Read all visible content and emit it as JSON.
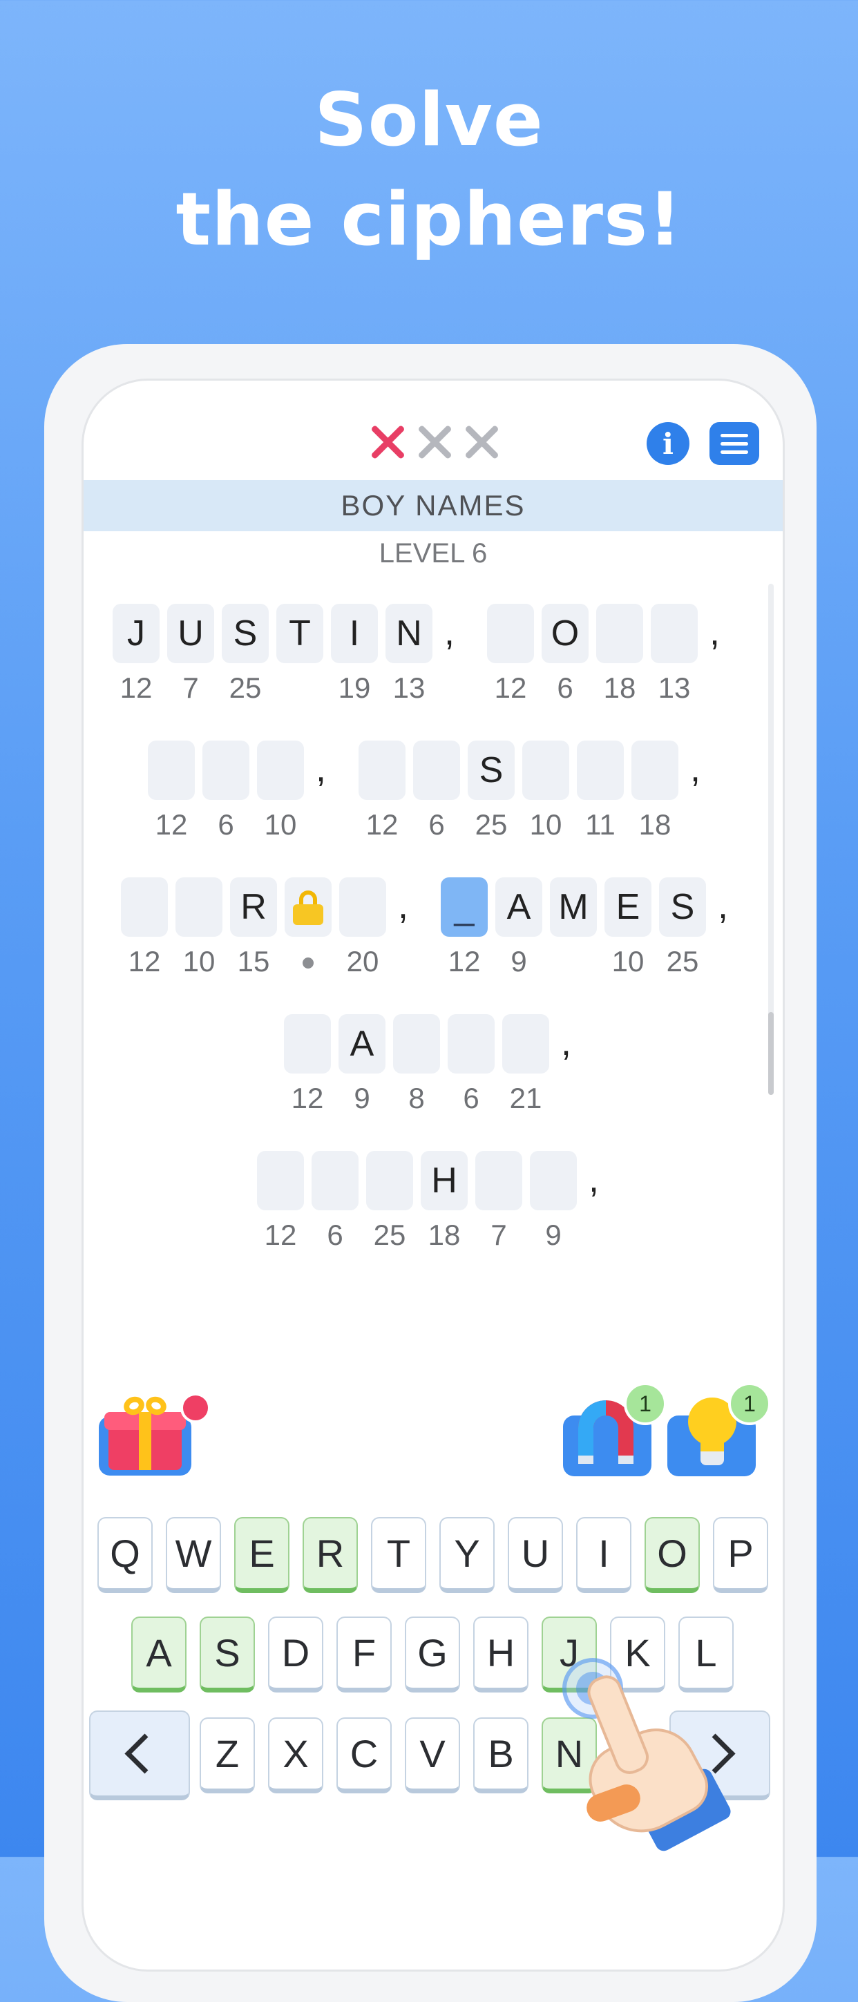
{
  "headline": {
    "line1": "Solve",
    "line2": "the ciphers!"
  },
  "game": {
    "mistakes": {
      "used": 1,
      "total": 3
    },
    "category": "BOY NAMES",
    "level": "LEVEL 6"
  },
  "puzzle": {
    "rows": [
      {
        "cells": [
          {
            "letter": "J",
            "num": "12"
          },
          {
            "letter": "U",
            "num": "7"
          },
          {
            "letter": "S",
            "num": "25"
          },
          {
            "letter": "T",
            "num": ""
          },
          {
            "letter": "I",
            "num": "19"
          },
          {
            "letter": "N",
            "num": "13"
          },
          {
            "punct": ","
          },
          {
            "letter": "",
            "num": "12"
          },
          {
            "letter": "O",
            "num": "6"
          },
          {
            "letter": "",
            "num": "18"
          },
          {
            "letter": "",
            "num": "13"
          },
          {
            "punct": ","
          }
        ]
      },
      {
        "cells": [
          {
            "letter": "",
            "num": "12"
          },
          {
            "letter": "",
            "num": "6"
          },
          {
            "letter": "",
            "num": "10"
          },
          {
            "punct": ","
          },
          {
            "letter": "",
            "num": "12"
          },
          {
            "letter": "",
            "num": "6"
          },
          {
            "letter": "S",
            "num": "25"
          },
          {
            "letter": "",
            "num": "10"
          },
          {
            "letter": "",
            "num": "11"
          },
          {
            "letter": "",
            "num": "18"
          },
          {
            "punct": ","
          }
        ]
      },
      {
        "cells": [
          {
            "letter": "",
            "num": "12"
          },
          {
            "letter": "",
            "num": "10"
          },
          {
            "letter": "R",
            "num": "15"
          },
          {
            "locked": true,
            "num": "•"
          },
          {
            "letter": "",
            "num": "20"
          },
          {
            "punct": ","
          },
          {
            "letter": "_",
            "num": "12",
            "active": true
          },
          {
            "letter": "A",
            "num": "9"
          },
          {
            "letter": "M",
            "num": ""
          },
          {
            "letter": "E",
            "num": "10"
          },
          {
            "letter": "S",
            "num": "25"
          },
          {
            "punct": ","
          }
        ]
      },
      {
        "cells": [
          {
            "letter": "",
            "num": "12"
          },
          {
            "letter": "A",
            "num": "9"
          },
          {
            "letter": "",
            "num": "8"
          },
          {
            "letter": "",
            "num": "6"
          },
          {
            "letter": "",
            "num": "21"
          },
          {
            "punct": ","
          }
        ]
      },
      {
        "cells": [
          {
            "letter": "",
            "num": "12"
          },
          {
            "letter": "",
            "num": "6"
          },
          {
            "letter": "",
            "num": "25"
          },
          {
            "letter": "H",
            "num": "18"
          },
          {
            "letter": "",
            "num": "7"
          },
          {
            "letter": "",
            "num": "9"
          },
          {
            "punct": ","
          }
        ]
      }
    ]
  },
  "helpers": {
    "gift": {
      "icon": "gift-icon",
      "has_notification": true
    },
    "magnet": {
      "icon": "magnet-icon",
      "count": "1"
    },
    "hint": {
      "icon": "lightbulb-icon",
      "count": "1"
    }
  },
  "keyboard": {
    "row1": [
      "Q",
      "W",
      "E",
      "R",
      "T",
      "Y",
      "U",
      "I",
      "O",
      "P"
    ],
    "row2": [
      "A",
      "S",
      "D",
      "F",
      "G",
      "H",
      "J",
      "K",
      "L"
    ],
    "row3": [
      "Z",
      "X",
      "C",
      "V",
      "B",
      "N"
    ],
    "used_keys": [
      "E",
      "R",
      "O",
      "A",
      "S",
      "J",
      "N"
    ],
    "back_icon": "chevron-left-icon",
    "forward_icon": "chevron-right-icon"
  },
  "colors": {
    "accent": "#2f80ea",
    "mistake_used": "#e83e65",
    "mistake_unused": "#b5b7bd",
    "used_key": "#e3f5df",
    "active_cell": "#7fb6f5",
    "badge": "#a6e59a"
  }
}
